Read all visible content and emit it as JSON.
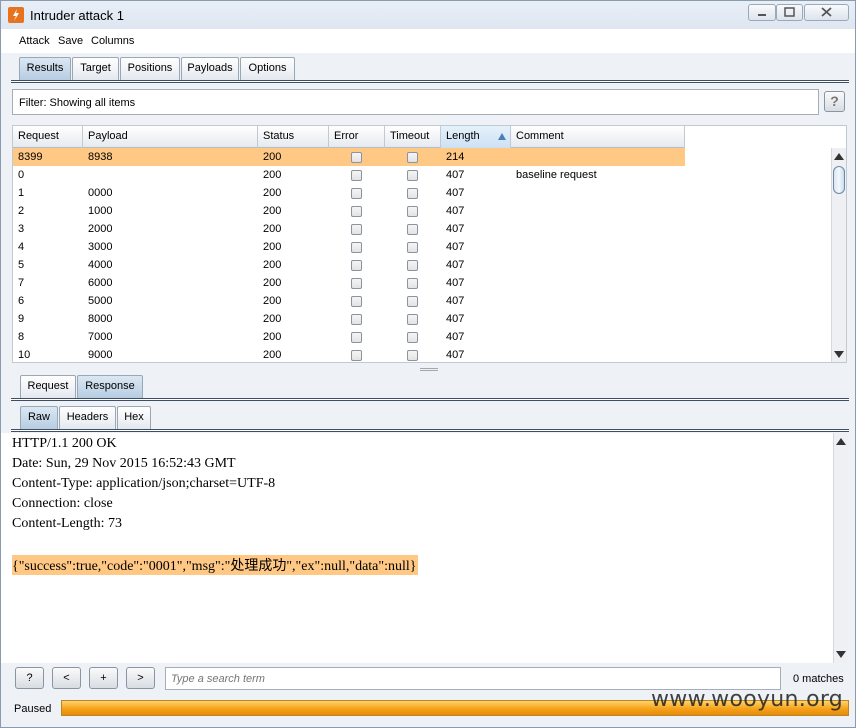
{
  "window": {
    "title": "Intruder attack 1"
  },
  "menu": {
    "items": [
      "Attack",
      "Save",
      "Columns"
    ]
  },
  "main_tabs": [
    {
      "label": "Results",
      "active": true
    },
    {
      "label": "Target"
    },
    {
      "label": "Positions"
    },
    {
      "label": "Payloads"
    },
    {
      "label": "Options"
    }
  ],
  "filter": {
    "text": "Filter:  Showing all items",
    "help": "?"
  },
  "table": {
    "columns": [
      "Request",
      "Payload",
      "Status",
      "Error",
      "Timeout",
      "Length",
      "Comment"
    ],
    "sorted_column": "Length",
    "rows": [
      {
        "request": "8399",
        "payload": "8938",
        "status": "200",
        "error": false,
        "timeout": false,
        "length": "214",
        "comment": "",
        "selected": true
      },
      {
        "request": "0",
        "payload": "",
        "status": "200",
        "error": false,
        "timeout": false,
        "length": "407",
        "comment": "baseline request"
      },
      {
        "request": "1",
        "payload": "0000",
        "status": "200",
        "error": false,
        "timeout": false,
        "length": "407",
        "comment": ""
      },
      {
        "request": "2",
        "payload": "1000",
        "status": "200",
        "error": false,
        "timeout": false,
        "length": "407",
        "comment": ""
      },
      {
        "request": "3",
        "payload": "2000",
        "status": "200",
        "error": false,
        "timeout": false,
        "length": "407",
        "comment": ""
      },
      {
        "request": "4",
        "payload": "3000",
        "status": "200",
        "error": false,
        "timeout": false,
        "length": "407",
        "comment": ""
      },
      {
        "request": "5",
        "payload": "4000",
        "status": "200",
        "error": false,
        "timeout": false,
        "length": "407",
        "comment": ""
      },
      {
        "request": "7",
        "payload": "6000",
        "status": "200",
        "error": false,
        "timeout": false,
        "length": "407",
        "comment": ""
      },
      {
        "request": "6",
        "payload": "5000",
        "status": "200",
        "error": false,
        "timeout": false,
        "length": "407",
        "comment": ""
      },
      {
        "request": "9",
        "payload": "8000",
        "status": "200",
        "error": false,
        "timeout": false,
        "length": "407",
        "comment": ""
      },
      {
        "request": "8",
        "payload": "7000",
        "status": "200",
        "error": false,
        "timeout": false,
        "length": "407",
        "comment": ""
      },
      {
        "request": "10",
        "payload": "9000",
        "status": "200",
        "error": false,
        "timeout": false,
        "length": "407",
        "comment": ""
      }
    ]
  },
  "detail_tabs": [
    {
      "label": "Request"
    },
    {
      "label": "Response",
      "active": true
    }
  ],
  "view_tabs": [
    {
      "label": "Raw",
      "active": true
    },
    {
      "label": "Headers"
    },
    {
      "label": "Hex"
    }
  ],
  "response": {
    "lines": [
      "HTTP/1.1 200 OK",
      "Date: Sun, 29 Nov 2015 16:52:43 GMT",
      "Content-Type: application/json;charset=UTF-8",
      "Connection: close",
      "Content-Length: 73",
      "",
      "{\"success\":true,\"code\":\"0001\",\"msg\":\"处理成功\",\"ex\":null,\"data\":null}"
    ],
    "highlight_line": 6
  },
  "search": {
    "buttons": [
      "?",
      "<",
      "+",
      ">"
    ],
    "placeholder": "Type a search term",
    "matches": "0 matches"
  },
  "status": {
    "label": "Paused",
    "progress_percent": 100
  },
  "watermark": "www.wooyun.org",
  "colors": {
    "highlight": "#ffc885",
    "progress": "#f6a21a",
    "brand": "#e8731e"
  },
  "icons": [
    "burp-app-icon",
    "minimize-icon",
    "maximize-icon",
    "close-icon",
    "sort-ascending-icon",
    "scroll-up-icon",
    "scroll-down-icon"
  ]
}
